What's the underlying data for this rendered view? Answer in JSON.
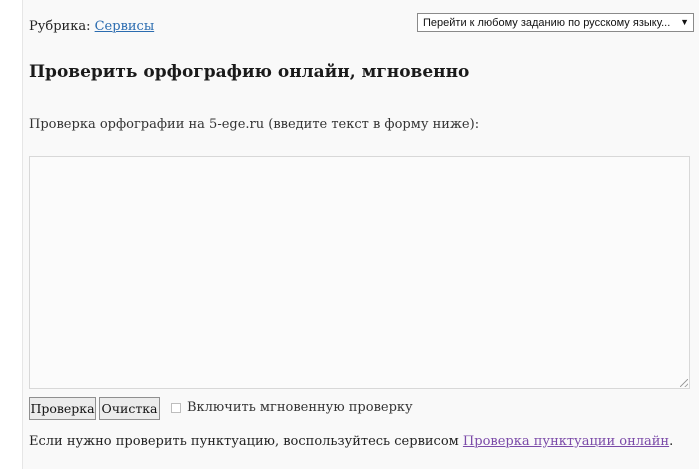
{
  "rubric": {
    "label": "Рубрика:",
    "link": "Сервисы"
  },
  "jump_select": {
    "selected": "Перейти к любому заданию по русскому языку...",
    "caret_icon": "chevron-down-icon"
  },
  "page_title": "Проверить орфографию онлайн, мгновенно",
  "intro_text": "Проверка орфографии на 5-ege.ru (введите текст в форму ниже):",
  "textarea": {
    "value": ""
  },
  "buttons": {
    "check_label": "Проверка",
    "clear_label": "Очистка"
  },
  "instant_check": {
    "label": "Включить мгновенную проверку",
    "checked": false
  },
  "footer": {
    "text": "Если нужно проверить пунктуацию, воспользуйтесь сервисом",
    "link": "Проверка пунктуации онлайн",
    "end": "."
  },
  "colors": {
    "link": "#2b6cb0",
    "visited_link": "#7b4aa8",
    "page_bg": "#f9f9f9"
  }
}
